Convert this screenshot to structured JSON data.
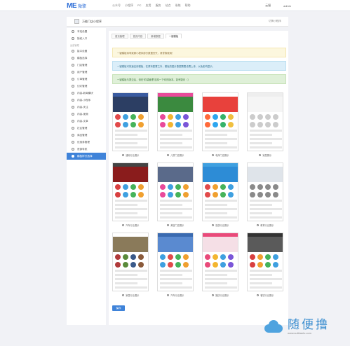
{
  "header": {
    "logo_mark": "ME",
    "logo_text": "微擎",
    "nav": [
      "公众号",
      "小程序",
      "PC",
      "应用",
      "服务",
      "站点",
      "系统",
      "帮助"
    ],
    "right": [
      "云服",
      "admin"
    ]
  },
  "app": {
    "name": "万能门店小程序",
    "switch_label": "切换小程序"
  },
  "sidebar": {
    "top_items": [
      "本站设置",
      "授权入口"
    ],
    "section_label": "运营管理",
    "items": [
      "接口设置",
      "模板选择",
      "门店管理",
      "用户管理",
      "订单管理",
      "幻灯管理",
      "内容-新闻模块",
      "内容-小程序",
      "内容-关注",
      "内容-视频",
      "内容-文章",
      "社区管理",
      "商品管理",
      "优惠券管理",
      "底部导航",
      "模板样式选择"
    ],
    "active_index": 15
  },
  "tabs": [
    "首页管理",
    "首页内容",
    "新增数据",
    "一键模板"
  ],
  "active_tab": 3,
  "notices": [
    "一键模板将导致原小程序部分数据丢失，请谨慎使用！",
    "一键模板可快速应用模板，在原有配置之外，模板的图片数据需要设置上传，以免影响显示。",
    "一键模板与提交后，请在“前端管理”选择一下你的版本。如有疑问（）"
  ],
  "templates": [
    {
      "name": "通用行业展示",
      "colors": {
        "bar": "#3a5ba0",
        "banner": "#2c3e63",
        "i1": "#e24a4a",
        "i2": "#3fa0e0",
        "i3": "#46b35a",
        "i4": "#f0a030"
      }
    },
    {
      "name": "儿童门店展示",
      "colors": {
        "bar": "#e94a9a",
        "banner": "#3b8a3f",
        "i1": "#e94a9a",
        "i2": "#f3b530",
        "i3": "#3fa0e0",
        "i4": "#7b56d8"
      }
    },
    {
      "name": "电商门店展示",
      "colors": {
        "bar": "#ffffff",
        "banner": "#e8413c",
        "i1": "#ff6a3a",
        "i2": "#2ea6ef",
        "i3": "#36b36a",
        "i4": "#f0c040"
      }
    },
    {
      "name": "家居展示",
      "colors": {
        "bar": "#eeeeee",
        "banner": "#f5f5f5",
        "i1": "#cccccc",
        "i2": "#cccccc",
        "i3": "#cccccc",
        "i4": "#cccccc"
      }
    },
    {
      "name": "汽车行业展示",
      "colors": {
        "bar": "#444444",
        "banner": "#8a1c1c",
        "i1": "#d84040",
        "i2": "#3fa0e0",
        "i3": "#46b35a",
        "i4": "#f0a030"
      }
    },
    {
      "name": "美容门店展示",
      "colors": {
        "bar": "#ffffff",
        "banner": "#5a6a8a",
        "i1": "#e94a9a",
        "i2": "#3fa0e0",
        "i3": "#46b35a",
        "i4": "#f0a030"
      }
    },
    {
      "name": "旅游行业展示",
      "colors": {
        "bar": "#3fa0e0",
        "banner": "#2d8cd6",
        "i1": "#e24a4a",
        "i2": "#f0a030",
        "i3": "#46b35a",
        "i4": "#3fa0e0"
      }
    },
    {
      "name": "教育行业展示",
      "colors": {
        "bar": "#ffffff",
        "banner": "#dfe4ea",
        "i1": "#8a8a8a",
        "i2": "#8a8a8a",
        "i3": "#8a8a8a",
        "i4": "#8a8a8a"
      }
    },
    {
      "name": "家居行业展示",
      "colors": {
        "bar": "#ffffff",
        "banner": "#8a7a5a",
        "i1": "#b03a3a",
        "i2": "#5a8a3a",
        "i3": "#3a5a8a",
        "i4": "#8a5a3a"
      }
    },
    {
      "name": "汽车行业展示",
      "colors": {
        "bar": "#3a6ab0",
        "banner": "#5a8ad0",
        "i1": "#3fa0e0",
        "i2": "#e24a4a",
        "i3": "#46b35a",
        "i4": "#f0a030"
      }
    },
    {
      "name": "婚庆行业展示",
      "colors": {
        "bar": "#e94a7a",
        "banner": "#f5dfe6",
        "i1": "#e94a7a",
        "i2": "#f3b530",
        "i3": "#3fa0e0",
        "i4": "#7b56d8"
      }
    },
    {
      "name": "餐饮行业展示",
      "colors": {
        "bar": "#333333",
        "banner": "#5a5a5a",
        "i1": "#d84040",
        "i2": "#f0a030",
        "i3": "#46b35a",
        "i4": "#3fa0e0"
      }
    }
  ],
  "save_label": "保存",
  "watermark": {
    "big": "随便撸",
    "small": "www.suibianlu.com"
  }
}
